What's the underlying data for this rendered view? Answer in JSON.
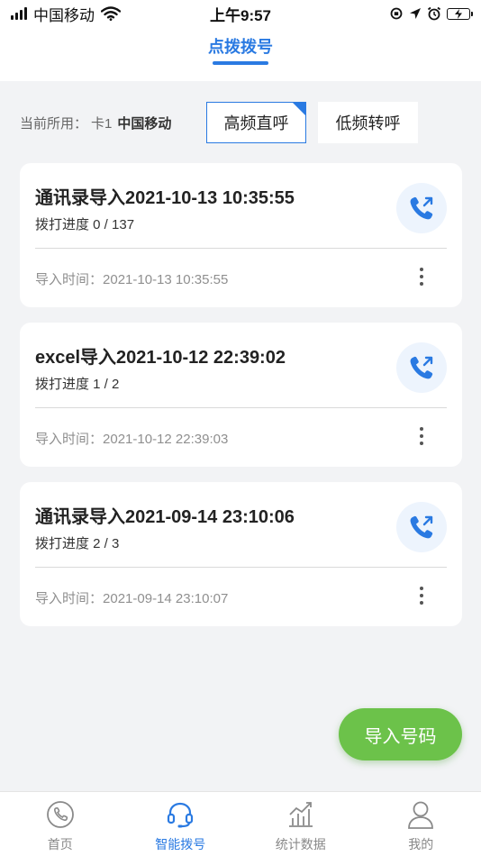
{
  "status_bar": {
    "carrier": "中国移动",
    "time": "上午9:57"
  },
  "header": {
    "title": "点拨拨号"
  },
  "line_selector": {
    "label": "当前所用：",
    "card": "卡1",
    "carrier": "中国移动",
    "modes": [
      {
        "label": "高频直呼",
        "selected": true
      },
      {
        "label": "低频转呼",
        "selected": false
      }
    ]
  },
  "imports": [
    {
      "title": "通讯录导入2021-10-13 10:35:55",
      "progress": "拨打进度 0 / 137",
      "time_label": "导入时间：",
      "time_value": "2021-10-13 10:35:55"
    },
    {
      "title": "excel导入2021-10-12 22:39:02",
      "progress": "拨打进度 1 / 2",
      "time_label": "导入时间：",
      "time_value": "2021-10-12 22:39:03"
    },
    {
      "title": "通讯录导入2021-09-14 23:10:06",
      "progress": "拨打进度 2 / 3",
      "time_label": "导入时间：",
      "time_value": "2021-09-14 23:10:07"
    }
  ],
  "import_button": {
    "label": "导入号码"
  },
  "tab_bar": {
    "items": [
      {
        "label": "首页",
        "icon": "phone-icon",
        "active": false
      },
      {
        "label": "智能拨号",
        "icon": "headset-icon",
        "active": true
      },
      {
        "label": "统计数据",
        "icon": "chart-icon",
        "active": false
      },
      {
        "label": "我的",
        "icon": "user-icon",
        "active": false
      }
    ]
  },
  "colors": {
    "accent": "#2a7ae2",
    "import_button": "#6cc24a",
    "background": "#f2f3f5"
  }
}
